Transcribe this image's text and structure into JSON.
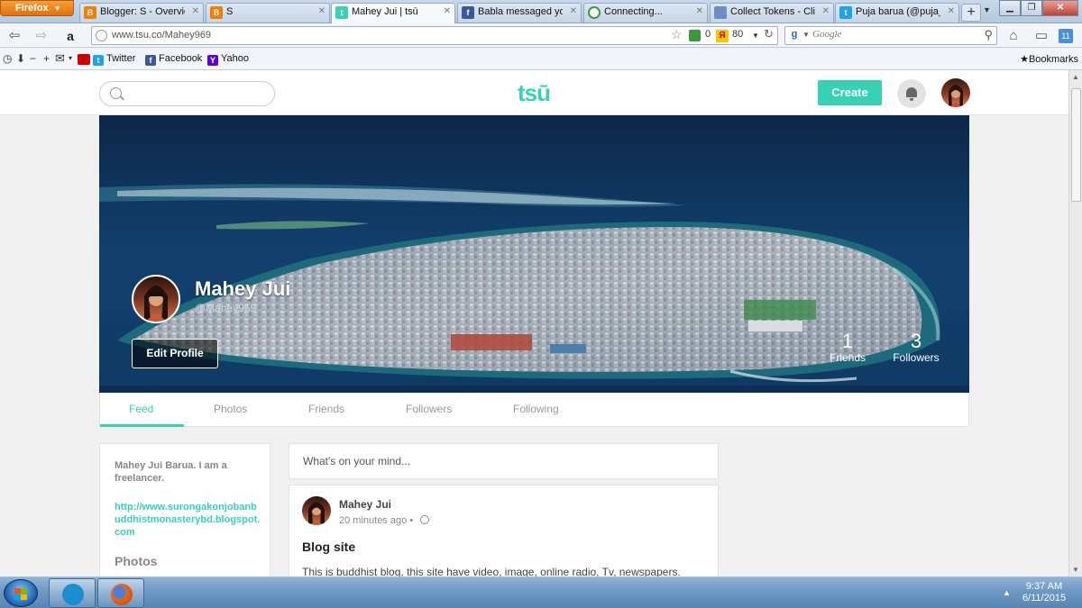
{
  "browser": {
    "menu_label": "Firefox",
    "tabs": [
      {
        "label": "Blogger: S - Overview",
        "icon": "blogger-icon"
      },
      {
        "label": "S",
        "icon": "blogger-icon"
      },
      {
        "label": "Mahey Jui | tsū",
        "icon": "tsu-icon",
        "active": true
      },
      {
        "label": "Babla messaged you",
        "icon": "facebook-icon"
      },
      {
        "label": "Connecting...",
        "icon": "loading-icon"
      },
      {
        "label": "Collect Tokens - Cli...",
        "icon": "page-icon"
      },
      {
        "label": "Puja barua (@puja_...",
        "icon": "twitter-icon"
      }
    ],
    "new_tab": "+",
    "url": "www.tsu.co/Mahey969",
    "addon_count_1": "0",
    "addon_count_2": "80",
    "search_placeholder": "Google",
    "bookmarks": [
      {
        "label": "Twitter",
        "icon": "twitter-icon"
      },
      {
        "label": "Facebook",
        "icon": "facebook-icon"
      },
      {
        "label": "Yahoo",
        "icon": "yahoo-icon"
      }
    ],
    "bookmarks_menu": "Bookmarks"
  },
  "site": {
    "logo": "tsū",
    "create_label": "Create",
    "accent_color": "#37d1b5"
  },
  "profile": {
    "name": "Mahey Jui",
    "handle": "@Mahey969",
    "edit_label": "Edit Profile",
    "friends_count": "1",
    "friends_label": "Friends",
    "followers_count": "3",
    "followers_label": "Followers",
    "tabs": [
      "Feed",
      "Photos",
      "Friends",
      "Followers",
      "Following"
    ],
    "active_tab": "Feed"
  },
  "about": {
    "bio": "Mahey Jui Barua. I am a freelancer.",
    "link": "http://www.surongakonjobanbuddhistmonasterybd.blogspot.com",
    "photos_heading": "Photos"
  },
  "composer": {
    "placeholder": "What's on your mind..."
  },
  "post": {
    "author": "Mahey Jui",
    "time": "20 minutes ago •",
    "title": "Blog site",
    "body": "This is buddhist blog, this site have video, image, online radio, Tv, newspapers."
  },
  "taskbar": {
    "time": "9:37 AM",
    "date": "6/11/2015"
  }
}
